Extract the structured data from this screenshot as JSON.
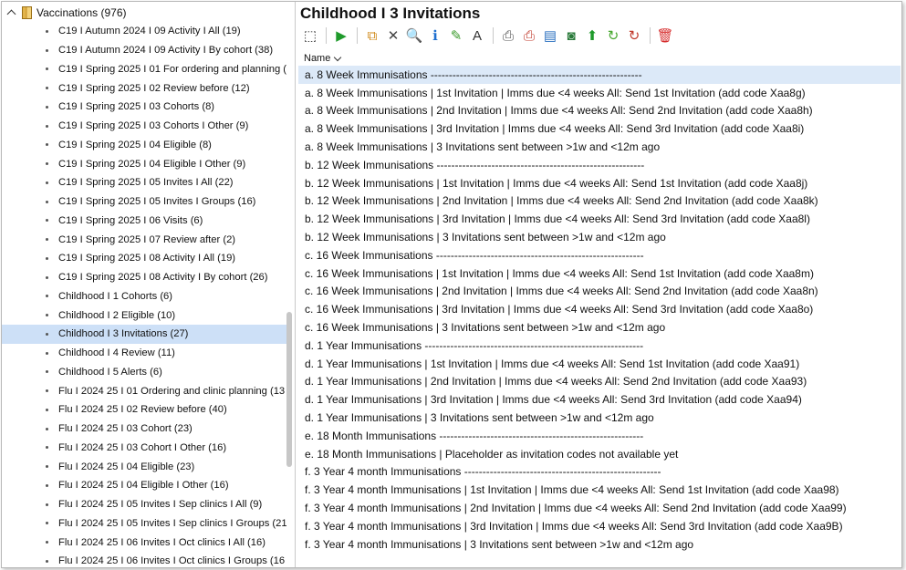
{
  "tree": {
    "root_label": "Vaccinations (976)",
    "items": [
      {
        "label": "C19 I Autumn 2024 I 09 Activity I All (19)",
        "selected": false
      },
      {
        "label": "C19 I Autumn 2024 I 09 Activity I By cohort (38)",
        "selected": false
      },
      {
        "label": "C19 I Spring 2025 I 01 For ordering and planning (",
        "selected": false
      },
      {
        "label": "C19 I Spring 2025 I 02 Review before (12)",
        "selected": false
      },
      {
        "label": "C19 I Spring 2025 I 03 Cohorts (8)",
        "selected": false
      },
      {
        "label": "C19 I Spring 2025 I 03 Cohorts I Other (9)",
        "selected": false
      },
      {
        "label": "C19 I Spring 2025 I 04 Eligible (8)",
        "selected": false
      },
      {
        "label": "C19 I Spring 2025 I 04 Eligible I Other (9)",
        "selected": false
      },
      {
        "label": "C19 I Spring 2025 I 05 Invites I All (22)",
        "selected": false
      },
      {
        "label": "C19 I Spring 2025 I 05 Invites I Groups (16)",
        "selected": false
      },
      {
        "label": "C19 I Spring 2025 I 06 Visits (6)",
        "selected": false
      },
      {
        "label": "C19 I Spring 2025 I 07 Review after (2)",
        "selected": false
      },
      {
        "label": "C19 I Spring 2025 I 08 Activity I All (19)",
        "selected": false
      },
      {
        "label": "C19 I Spring 2025 I 08 Activity I By cohort (26)",
        "selected": false
      },
      {
        "label": "Childhood I 1 Cohorts (6)",
        "selected": false
      },
      {
        "label": "Childhood I 2 Eligible (10)",
        "selected": false
      },
      {
        "label": "Childhood I 3 Invitations (27)",
        "selected": true
      },
      {
        "label": "Childhood I 4 Review (11)",
        "selected": false
      },
      {
        "label": "Childhood I 5 Alerts (6)",
        "selected": false
      },
      {
        "label": "Flu I 2024 25 I 01 Ordering and clinic planning (13",
        "selected": false
      },
      {
        "label": "Flu I 2024 25 I 02 Review before (40)",
        "selected": false
      },
      {
        "label": "Flu I 2024 25 I 03 Cohort (23)",
        "selected": false
      },
      {
        "label": "Flu I 2024 25 I 03 Cohort I Other (16)",
        "selected": false
      },
      {
        "label": "Flu I 2024 25 I 04 Eligible (23)",
        "selected": false
      },
      {
        "label": "Flu I 2024 25 I 04 Eligible I Other (16)",
        "selected": false
      },
      {
        "label": "Flu I 2024 25 I 05 Invites I Sep clinics I All (9)",
        "selected": false
      },
      {
        "label": "Flu I 2024 25 I 05 Invites I Sep clinics I Groups (21",
        "selected": false
      },
      {
        "label": "Flu I 2024 25 I 06 Invites I Oct clinics I All (16)",
        "selected": false
      },
      {
        "label": "Flu I 2024 25 I 06 Invites I Oct clinics I Groups (16",
        "selected": false
      }
    ]
  },
  "pane": {
    "title": "Childhood I 3 Invitations",
    "column_header": "Name",
    "toolbar": [
      {
        "name": "select-box-icon",
        "glyph": "⬚",
        "color": "#333333"
      },
      {
        "name": "run-icon",
        "glyph": "▶",
        "color": "#1f9a2b"
      },
      {
        "name": "copy-icon",
        "glyph": "⧉",
        "color": "#d08a1a"
      },
      {
        "name": "delete-x-icon",
        "glyph": "✕",
        "color": "#444444"
      },
      {
        "name": "search-icon",
        "glyph": "🔍",
        "color": "#333333"
      },
      {
        "name": "info-icon",
        "glyph": "ℹ",
        "color": "#1e6fd0"
      },
      {
        "name": "edit-pen-icon",
        "glyph": "✎",
        "color": "#3a9a2a"
      },
      {
        "name": "font-icon",
        "glyph": "A",
        "color": "#333333"
      },
      {
        "name": "print-icon",
        "glyph": "⎙",
        "color": "#555555"
      },
      {
        "name": "print-red-icon",
        "glyph": "⎙",
        "color": "#c0392b"
      },
      {
        "name": "report-icon",
        "glyph": "▤",
        "color": "#2a6fc0"
      },
      {
        "name": "screen-icon",
        "glyph": "◙",
        "color": "#2a7a3a"
      },
      {
        "name": "upload-icon",
        "glyph": "⬆",
        "color": "#1f9a2b"
      },
      {
        "name": "refresh-icon",
        "glyph": "↻",
        "color": "#48a82f"
      },
      {
        "name": "refresh-red-icon",
        "glyph": "↻",
        "color": "#c0392b"
      },
      {
        "name": "trash-icon",
        "glyph": "🗑",
        "color": "#d62d2d"
      }
    ],
    "rows": [
      {
        "text": "a. 8 Week Immunisations ----------------------------------------------------------",
        "selected": true
      },
      {
        "text": "a. 8 Week Immunisations |  1st Invitation | Imms due <4 weeks All: Send 1st Invitation (add code Xaa8g)",
        "selected": false
      },
      {
        "text": "a. 8 Week Immunisations |  2nd Invitation | Imms due <4 weeks All: Send 2nd Invitation (add code Xaa8h)",
        "selected": false
      },
      {
        "text": "a. 8 Week Immunisations |  3rd Invitation | Imms due <4 weeks All: Send 3rd Invitation (add code Xaa8i)",
        "selected": false
      },
      {
        "text": "a. 8 Week Immunisations | 3 Invitations sent between >1w and <12m ago",
        "selected": false
      },
      {
        "text": "b. 12 Week Immunisations ---------------------------------------------------------",
        "selected": false
      },
      {
        "text": "b. 12 Week Immunisations |  1st Invitation | Imms due <4 weeks All: Send 1st Invitation (add code Xaa8j)",
        "selected": false
      },
      {
        "text": "b. 12 Week Immunisations |  2nd Invitation | Imms due <4 weeks All: Send 2nd Invitation (add code Xaa8k)",
        "selected": false
      },
      {
        "text": "b. 12 Week Immunisations |  3rd Invitation | Imms due <4 weeks All: Send 3rd Invitation (add code Xaa8l)",
        "selected": false
      },
      {
        "text": "b. 12 Week Immunisations | 3 Invitations sent between >1w and <12m ago",
        "selected": false
      },
      {
        "text": "c. 16 Week Immunisations ---------------------------------------------------------",
        "selected": false
      },
      {
        "text": "c. 16 Week Immunisations |  1st Invitation | Imms due <4 weeks All: Send 1st Invitation (add code Xaa8m)",
        "selected": false
      },
      {
        "text": "c. 16 Week Immunisations |  2nd Invitation | Imms due <4 weeks All: Send 2nd Invitation (add code Xaa8n)",
        "selected": false
      },
      {
        "text": "c. 16 Week Immunisations |  3rd Invitation | Imms due <4 weeks All: Send 3rd Invitation (add code Xaa8o)",
        "selected": false
      },
      {
        "text": "c. 16 Week Immunisations | 3 Invitations sent between >1w and <12m ago",
        "selected": false
      },
      {
        "text": "d. 1 Year Immunisations ------------------------------------------------------------",
        "selected": false
      },
      {
        "text": "d. 1 Year Immunisations |  1st Invitation | Imms due <4 weeks All: Send 1st Invitation (add code Xaa91)",
        "selected": false
      },
      {
        "text": "d. 1 Year Immunisations |  2nd Invitation | Imms due <4 weeks All: Send 2nd Invitation (add code Xaa93)",
        "selected": false
      },
      {
        "text": "d. 1 Year Immunisations |  3rd Invitation | Imms due <4 weeks All: Send 3rd Invitation (add code Xaa94)",
        "selected": false
      },
      {
        "text": "d. 1 Year Immunisations | 3 Invitations sent between >1w and <12m ago",
        "selected": false
      },
      {
        "text": "e. 18 Month Immunisations --------------------------------------------------------",
        "selected": false
      },
      {
        "text": "e. 18 Month Immunisations | Placeholder as invitation codes not available yet",
        "selected": false
      },
      {
        "text": "f.  3 Year 4 month Immunisations ------------------------------------------------------",
        "selected": false
      },
      {
        "text": "f.  3 Year 4 month Immunisations |  1st Invitation | Imms due <4 weeks All: Send 1st Invitation (add code Xaa98)",
        "selected": false
      },
      {
        "text": "f.  3 Year 4 month Immunisations |  2nd Invitation | Imms due <4 weeks All: Send 2nd Invitation (add code Xaa99)",
        "selected": false
      },
      {
        "text": "f.  3 Year 4 month Immunisations |  3rd Invitation | Imms due <4 weeks All: Send 3rd Invitation (add code Xaa9B)",
        "selected": false
      },
      {
        "text": "f.  3 Year 4 month Immunisations | 3 Invitations sent between >1w and <12m ago",
        "selected": false
      }
    ]
  }
}
